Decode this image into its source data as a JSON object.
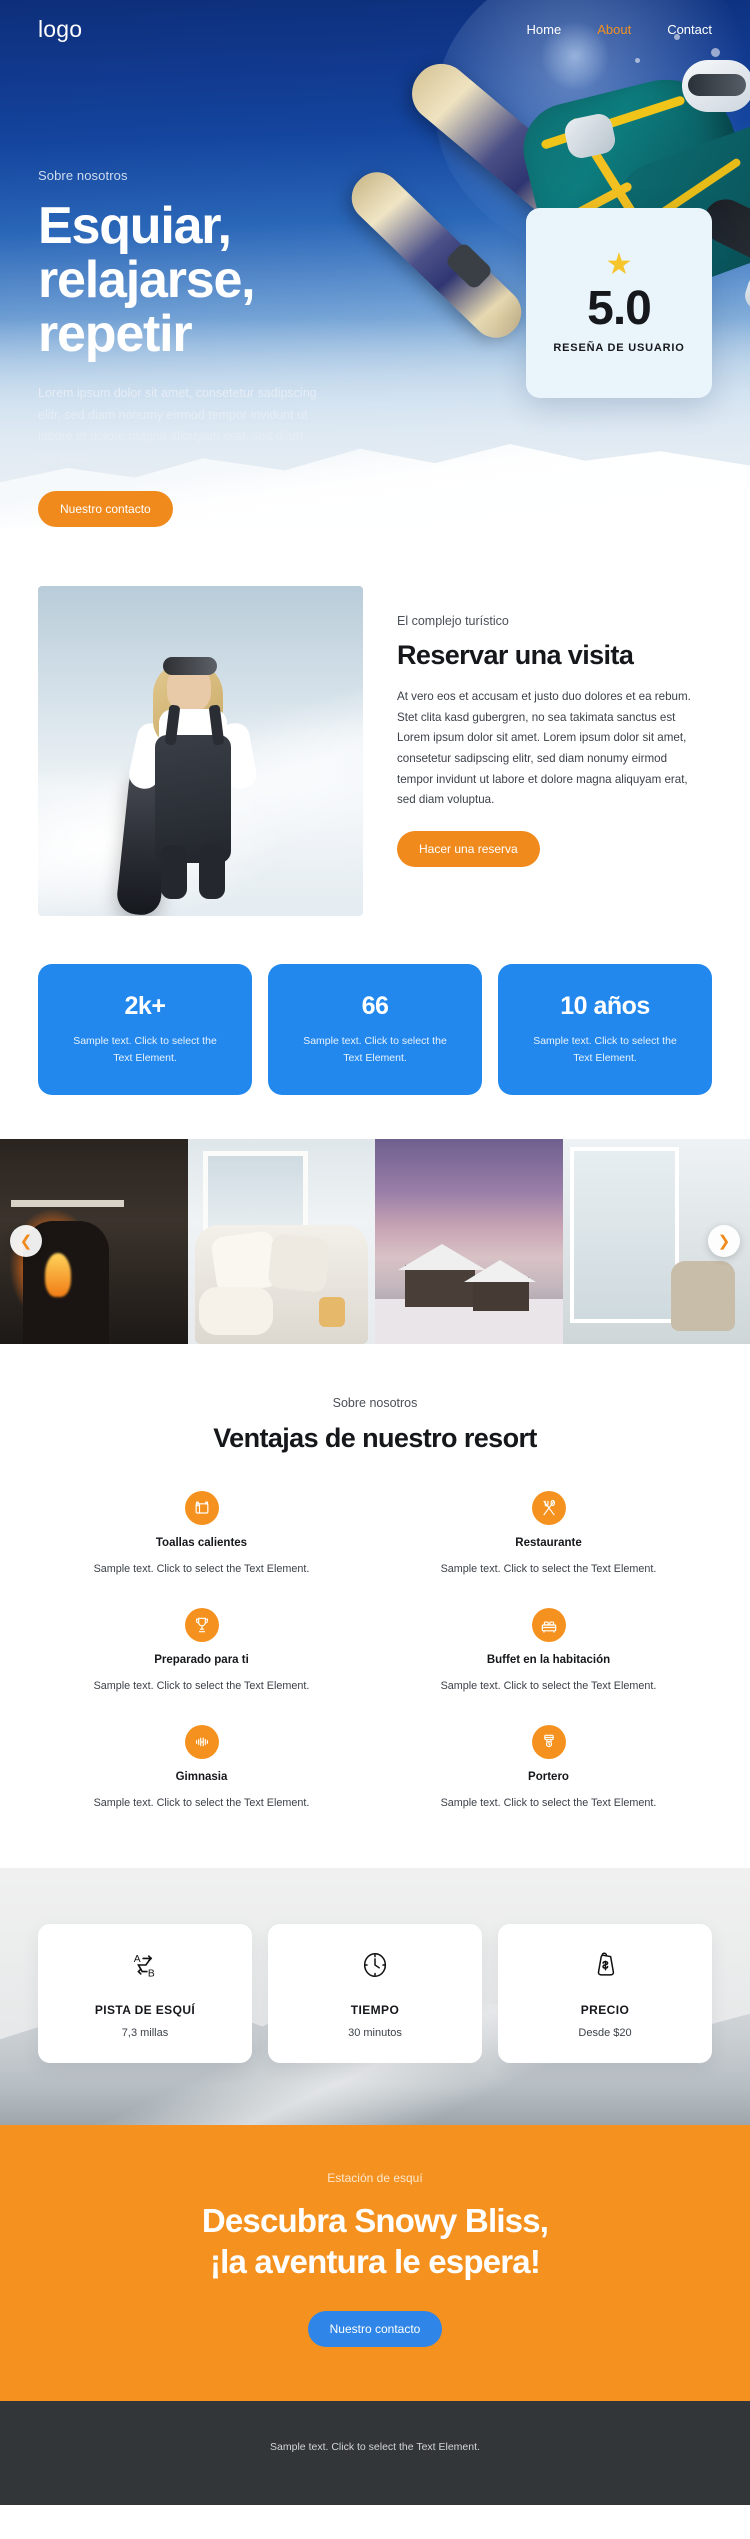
{
  "header": {
    "logo": "logo",
    "nav": [
      {
        "label": "Home",
        "active": false
      },
      {
        "label": "About",
        "active": true
      },
      {
        "label": "Contact",
        "active": false
      }
    ]
  },
  "hero": {
    "eyebrow": "Sobre nosotros",
    "title": "Esquiar, relajarse, repetir",
    "text": "Lorem ipsum dolor sit amet, consetetur sadipscing elitr, sed diam nonumy eirmod tempor invidunt ut labore et dolore magna aliquyam erat, sed diam voluptua.",
    "cta_label": "Nuestro contacto",
    "rating": {
      "star_icon": "star-icon",
      "value": "5.0",
      "label": "RESEÑA DE USUARIO"
    }
  },
  "booking": {
    "kicker": "El complejo turístico",
    "title": "Reservar una visita",
    "text": "At vero eos et accusam et justo duo dolores et ea rebum. Stet clita kasd gubergren, no sea takimata sanctus est Lorem ipsum dolor sit amet. Lorem ipsum dolor sit amet, consetetur sadipscing elitr, sed diam nonumy eirmod tempor invidunt ut labore et dolore magna aliquyam erat, sed diam voluptua.",
    "cta_label": "Hacer una reserva"
  },
  "stats": [
    {
      "number": "2k+",
      "text": "Sample text. Click to select the Text Element."
    },
    {
      "number": "66",
      "text": "Sample text. Click to select the Text Element."
    },
    {
      "number": "10 años",
      "text": "Sample text. Click to select the Text Element."
    }
  ],
  "gallery": {
    "prev_icon": "chevron-left-icon",
    "next_icon": "chevron-right-icon"
  },
  "advantages": {
    "kicker": "Sobre nosotros",
    "title": "Ventajas de nuestro resort",
    "features": [
      {
        "icon": "towel-icon",
        "title": "Toallas calientes",
        "text": "Sample text. Click to select the Text Element."
      },
      {
        "icon": "cutlery-icon",
        "title": "Restaurante",
        "text": "Sample text. Click to select the Text Element."
      },
      {
        "icon": "trophy-icon",
        "title": "Preparado para ti",
        "text": "Sample text. Click to select the Text Element."
      },
      {
        "icon": "bed-icon",
        "title": "Buffet en la habitación",
        "text": "Sample text. Click to select the Text Element."
      },
      {
        "icon": "dumbbell-icon",
        "title": "Gimnasia",
        "text": "Sample text. Click to select the Text Element."
      },
      {
        "icon": "bellhop-icon",
        "title": "Portero",
        "text": "Sample text. Click to select the Text Element."
      }
    ]
  },
  "info_cards": [
    {
      "icon": "route-a-to-b-icon",
      "title": "PISTA DE ESQUÍ",
      "value": "7,3 millas"
    },
    {
      "icon": "clock-icon",
      "title": "TIEMPO",
      "value": "30 minutos"
    },
    {
      "icon": "price-tag-icon",
      "title": "PRECIO",
      "value": "Desde $20"
    }
  ],
  "cta": {
    "kicker": "Estación de esquí",
    "title_line1": "Descubra Snowy Bliss,",
    "title_line2": "¡la aventura le espera!",
    "button_label": "Nuestro contacto"
  },
  "footer": {
    "text": "Sample text. Click to select the Text Element."
  },
  "colors": {
    "orange": "#f5911e",
    "blue": "#2288ee",
    "hero_blue": "#14459e",
    "dark": "#333638"
  }
}
